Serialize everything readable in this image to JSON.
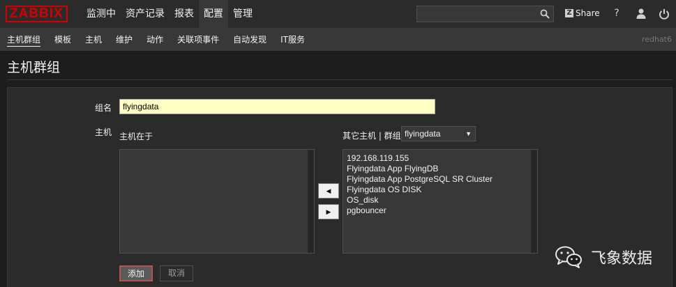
{
  "header": {
    "logo": "ZABBIX",
    "menu": [
      "监测中",
      "资产记录",
      "报表",
      "配置",
      "管理"
    ],
    "active_menu": "配置",
    "search": {
      "value": "",
      "placeholder": ""
    },
    "share_label": "Share",
    "help_icon": "question-icon",
    "user_icon": "user-icon",
    "logout_icon": "power-icon"
  },
  "submenu": {
    "items": [
      "主机群组",
      "模板",
      "主机",
      "维护",
      "动作",
      "关联项事件",
      "自动发现",
      "IT服务"
    ],
    "active": "主机群组",
    "server_name": "redhat6"
  },
  "page": {
    "title": "主机群组"
  },
  "form": {
    "group_name_label": "组名",
    "group_name_value": "flyingdata",
    "hosts_label": "主机",
    "in_group_label": "主机在于",
    "in_group_hosts": [],
    "other_label": "其它主机 | 群组",
    "other_group_select": "flyingdata",
    "other_hosts": [
      "192.168.119.155",
      "Flyingdata App FlyingDB",
      "Flyingdata App PostgreSQL SR Cluster",
      "Flyingdata OS DISK",
      "OS_disk",
      "pgbouncer"
    ],
    "add_button": "添加",
    "cancel_button": "取消"
  },
  "watermark": {
    "text": "飞象数据",
    "icon": "wechat-icon"
  },
  "colors": {
    "brand": "#d40000",
    "topbar": "#2b2b2b",
    "input_highlight": "#fffec4",
    "primary_button_border": "#b8544f"
  }
}
